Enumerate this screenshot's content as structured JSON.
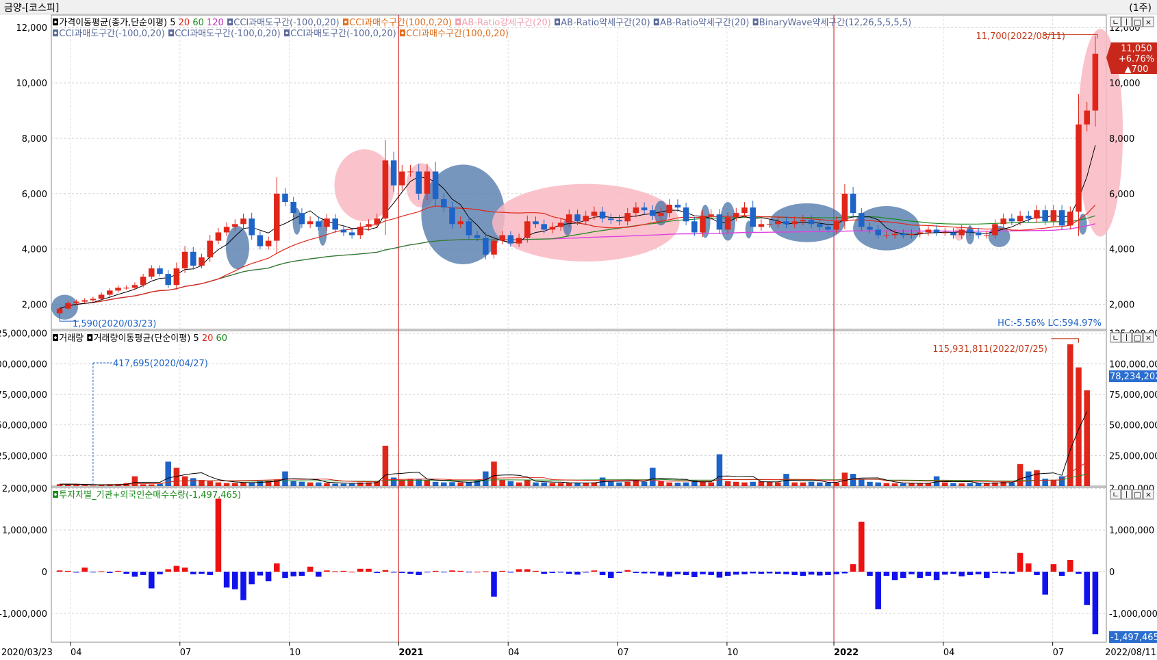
{
  "window": {
    "title": "금양-[코스피]",
    "period": "(1주)"
  },
  "colors": {
    "up": "#e0261a",
    "down": "#1e64c8",
    "ma5": "#000000",
    "ma20": "#e0261a",
    "ma60": "#1b8a1b",
    "ma120": "#e040e0",
    "pink_zone": "#f9b8c2",
    "blue_zone": "#4a73a8",
    "year_line": "#d43030"
  },
  "price_panel": {
    "legend_row1": [
      {
        "text": "가격이동평균(종가,단순이평)",
        "color": "#000000",
        "icon": "indicator-icon"
      },
      {
        "text": "5",
        "color": "#000000"
      },
      {
        "text": "20",
        "color": "#e0261a"
      },
      {
        "text": "60",
        "color": "#1b8a1b"
      },
      {
        "text": "120",
        "color": "#c030c0"
      },
      {
        "text": "CCI과매도구간(-100,0,20)",
        "color": "#5a6a9a",
        "icon": "indicator-icon"
      },
      {
        "text": "CCI과매수구간(100,0,20)",
        "color": "#e07020",
        "icon": "indicator-icon"
      },
      {
        "text": "AB-Ratio강세구간(20)",
        "color": "#f2a0b0",
        "icon": "indicator-icon"
      },
      {
        "text": "AB-Ratio약세구간(20)",
        "color": "#5a6a9a",
        "icon": "indicator-icon"
      },
      {
        "text": "AB-Ratio약세구간(20)",
        "color": "#5a6a9a",
        "icon": "indicator-icon"
      },
      {
        "text": "BinaryWave약세구간(12,26,5,5,5,5)",
        "color": "#5a6a9a",
        "icon": "indicator-icon"
      }
    ],
    "legend_row2": [
      {
        "text": "CCI과매도구간(-100,0,20)",
        "color": "#5a6a9a",
        "icon": "indicator-icon"
      },
      {
        "text": "CCI과매도구간(-100,0,20)",
        "color": "#5a6a9a",
        "icon": "indicator-icon"
      },
      {
        "text": "CCI과매도구간(-100,0,20)",
        "color": "#5a6a9a",
        "icon": "indicator-icon"
      },
      {
        "text": "CCI과매수구간(100,0,20)",
        "color": "#e07020",
        "icon": "indicator-icon"
      }
    ],
    "high_label": "11,700(2022/08/11)",
    "low_label": "1,590(2020/03/23)",
    "current_price": {
      "price": "11,050",
      "change_pct": "+6.76%",
      "change": "▲700"
    },
    "hc_lc": "HC:-5.56%  LC:594.97%",
    "window_buttons": [
      "ㄴ",
      "ㅣ",
      "□",
      "×"
    ]
  },
  "volume_panel": {
    "legend": [
      {
        "text": "거래량",
        "color": "#000000",
        "icon": "indicator-icon"
      },
      {
        "text": "거래량이동평균(단순이평)",
        "color": "#000000",
        "icon": "indicator-icon"
      },
      {
        "text": "5",
        "color": "#000000"
      },
      {
        "text": "20",
        "color": "#e0261a"
      },
      {
        "text": "60",
        "color": "#1b8a1b"
      }
    ],
    "high_label": "115,931,811(2022/07/25)",
    "low_label": "417,695(2020/04/27)",
    "current_value": "78,234,202",
    "window_buttons": [
      "ㄴ",
      "ㅣ",
      "□",
      "×"
    ]
  },
  "investor_panel": {
    "legend": [
      {
        "text": "투자자별_기관+외국인순매수수량(-1,497,465)",
        "color": "#1b8a1b",
        "icon": "indicator-icon"
      }
    ],
    "current_value": "-1,497,465",
    "window_buttons": [
      "ㄴ",
      "ㅣ",
      "□",
      "×"
    ]
  },
  "x_axis": {
    "start_label": "2020/03/23",
    "end_label": "2022/08/11",
    "ticks": [
      {
        "label": "04",
        "week": 1.3,
        "bold": false
      },
      {
        "label": "07",
        "week": 14.4,
        "bold": false
      },
      {
        "label": "10",
        "week": 27.5,
        "bold": false
      },
      {
        "label": "2021",
        "week": 40.6,
        "bold": true
      },
      {
        "label": "04",
        "week": 53.7,
        "bold": false
      },
      {
        "label": "07",
        "week": 66.8,
        "bold": false
      },
      {
        "label": "10",
        "week": 79.9,
        "bold": false
      },
      {
        "label": "2022",
        "week": 92.7,
        "bold": true
      },
      {
        "label": "04",
        "week": 105.8,
        "bold": false
      },
      {
        "label": "07",
        "week": 118.9,
        "bold": false
      }
    ],
    "year_lines_week": [
      40.6,
      92.7
    ]
  },
  "chart_data": [
    {
      "type": "candlestick",
      "x_unit": "week index from 2020/03/23",
      "y_ticks": [
        {
          "v": 2000,
          "label": "2,000"
        },
        {
          "v": 4000,
          "label": "4,000"
        },
        {
          "v": 6000,
          "label": "6,000"
        },
        {
          "v": 8000,
          "label": "8,000"
        },
        {
          "v": 10000,
          "label": "10,000"
        },
        {
          "v": 12000,
          "label": "12,000"
        }
      ],
      "ylim": [
        1100,
        12450
      ],
      "close": [
        1850,
        2050,
        2100,
        2150,
        2200,
        2350,
        2500,
        2600,
        2600,
        2700,
        3000,
        3300,
        3100,
        2700,
        3300,
        3900,
        3400,
        3700,
        4300,
        4600,
        4800,
        4900,
        5100,
        4500,
        4100,
        4300,
        6000,
        5700,
        5300,
        4900,
        5000,
        4800,
        5100,
        4700,
        4600,
        4500,
        4800,
        4900,
        5100,
        7200,
        6300,
        6800,
        6800,
        6000,
        6800,
        5800,
        5500,
        4900,
        5000,
        4500,
        4400,
        3800,
        4300,
        4500,
        4200,
        4400,
        5000,
        4900,
        4700,
        4800,
        4950,
        5250,
        5000,
        5200,
        5350,
        5100,
        5050,
        5000,
        5300,
        5500,
        5400,
        5200,
        5300,
        5600,
        5500,
        5000,
        4600,
        5200,
        5250,
        4700,
        5150,
        5300,
        5500,
        4800,
        4900,
        4900,
        5000,
        4900,
        5000,
        5050,
        4900,
        4800,
        4700,
        5000,
        6000,
        5300,
        4800,
        4700,
        4500,
        4500,
        4550,
        4500,
        4550,
        4600,
        4700,
        4600,
        4600,
        4500,
        4700,
        4600,
        4500,
        4500,
        4900,
        5100,
        5000,
        5200,
        5100,
        5400,
        5000,
        5400,
        4850,
        5350,
        8500,
        9000,
        11050
      ],
      "ma_legend_periods": [
        5,
        20,
        60,
        120
      ],
      "high_point": {
        "week": 124,
        "value": 11700
      },
      "low_point": {
        "week": 0,
        "value": 1590
      },
      "zones": [
        {
          "kind": "blue",
          "cx": 0.6,
          "cy": 1900,
          "rx": 1.6,
          "ry": 450
        },
        {
          "kind": "blue",
          "cx": 21.3,
          "cy": 4050,
          "rx": 1.4,
          "ry": 780
        },
        {
          "kind": "blue",
          "cx": 28.4,
          "cy": 5000,
          "rx": 0.5,
          "ry": 480
        },
        {
          "kind": "blue",
          "cx": 31.5,
          "cy": 4600,
          "rx": 0.5,
          "ry": 480
        },
        {
          "kind": "pink",
          "cx": 36.5,
          "cy": 6300,
          "rx": 3.6,
          "ry": 1300
        },
        {
          "kind": "pink",
          "cx": 43.3,
          "cy": 6300,
          "rx": 1.8,
          "ry": 800
        },
        {
          "kind": "blue",
          "cx": 48.3,
          "cy": 5250,
          "rx": 5.0,
          "ry": 1800
        },
        {
          "kind": "pink",
          "cx": 63.0,
          "cy": 4950,
          "rx": 11.2,
          "ry": 1400
        },
        {
          "kind": "blue",
          "cx": 60.8,
          "cy": 4800,
          "rx": 0.5,
          "ry": 320
        },
        {
          "kind": "blue",
          "cx": 72.0,
          "cy": 5300,
          "rx": 0.8,
          "ry": 450
        },
        {
          "kind": "blue",
          "cx": 77.3,
          "cy": 5000,
          "rx": 0.6,
          "ry": 600
        },
        {
          "kind": "blue",
          "cx": 80.0,
          "cy": 5000,
          "rx": 0.9,
          "ry": 700
        },
        {
          "kind": "blue",
          "cx": 82.5,
          "cy": 4700,
          "rx": 0.4,
          "ry": 320
        },
        {
          "kind": "blue",
          "cx": 89.5,
          "cy": 4950,
          "rx": 4.5,
          "ry": 700
        },
        {
          "kind": "blue",
          "cx": 99.0,
          "cy": 4750,
          "rx": 4.0,
          "ry": 800
        },
        {
          "kind": "pink",
          "cx": 107.7,
          "cy": 4550,
          "rx": 0.6,
          "ry": 250
        },
        {
          "kind": "blue",
          "cx": 109.0,
          "cy": 4500,
          "rx": 0.5,
          "ry": 330
        },
        {
          "kind": "blue",
          "cx": 112.5,
          "cy": 4450,
          "rx": 1.3,
          "ry": 380
        },
        {
          "kind": "blue",
          "cx": 122.5,
          "cy": 4900,
          "rx": 0.5,
          "ry": 380
        },
        {
          "kind": "pink",
          "cx": 124.6,
          "cy": 8200,
          "rx": 2.7,
          "ry": 3750
        }
      ]
    },
    {
      "type": "bar",
      "title": "거래량",
      "x_unit": "week index from 2020/03/23",
      "y_ticks": [
        {
          "v": 25000000,
          "label": "25,000,000"
        },
        {
          "v": 50000000,
          "label": "50,000,000"
        },
        {
          "v": 75000000,
          "label": "75,000,000"
        },
        {
          "v": 100000000,
          "label": "100,000,000"
        },
        {
          "v": 125000000,
          "label": "125,000,000"
        }
      ],
      "ylim": [
        0,
        127000000
      ],
      "values": [
        1500000,
        1800000,
        1200000,
        900000,
        417695,
        1000000,
        1500000,
        1600000,
        2500000,
        8000000,
        1500000,
        1400000,
        2000000,
        20000000,
        15000000,
        8000000,
        6500000,
        5000000,
        4000000,
        3000000,
        2500000,
        2600000,
        3000000,
        3000000,
        4000000,
        4500000,
        5500000,
        12000000,
        4000000,
        3500000,
        3000000,
        3000000,
        2500000,
        2000000,
        2000000,
        2000000,
        3000000,
        3000000,
        4000000,
        33000000,
        7000000,
        5000000,
        6000000,
        5500000,
        5000000,
        3500000,
        3000000,
        3200000,
        3000000,
        3000000,
        5000000,
        12000000,
        20000000,
        5000000,
        4000000,
        3000000,
        5000000,
        3000000,
        3000000,
        2500000,
        2500000,
        2700000,
        2500000,
        2800000,
        3000000,
        7000000,
        4000000,
        3000000,
        3500000,
        5000000,
        3500000,
        15000000,
        4000000,
        3000000,
        2800000,
        3000000,
        5000000,
        3500000,
        3000000,
        26000000,
        4000000,
        3500000,
        3000000,
        3500000,
        4000000,
        3500000,
        3000000,
        10000000,
        3000000,
        3000000,
        3500000,
        3000000,
        2800000,
        2800000,
        11000000,
        10000000,
        6000000,
        3500000,
        3000000,
        2500000,
        2200000,
        2200000,
        2300000,
        2400000,
        2500000,
        8000000,
        3000000,
        2500000,
        2200000,
        2500000,
        2500000,
        2200000,
        3000000,
        3500000,
        3000000,
        18000000,
        12000000,
        13000000,
        6000000,
        5000000,
        8000000,
        115931811,
        97000000,
        78234202
      ],
      "colors_by_candle": true,
      "high_point": {
        "week": 122,
        "value": 115931811
      },
      "low_point": {
        "week": 4,
        "value": 417695
      }
    },
    {
      "type": "bar",
      "title": "투자자별_기관+외국인순매수수량",
      "x_unit": "week index from 2020/03/23",
      "y_ticks": [
        {
          "v": -1000000,
          "label": "-1,000,000"
        },
        {
          "v": 0,
          "label": "0"
        },
        {
          "v": 1000000,
          "label": "1,000,000"
        },
        {
          "v": 2000000,
          "label": "2,000,000"
        }
      ],
      "ylim": [
        -1690000,
        2020000
      ],
      "values": [
        30000,
        20000,
        -20000,
        100000,
        -10000,
        10000,
        -30000,
        20000,
        -50000,
        -120000,
        -80000,
        -400000,
        -60000,
        60000,
        140000,
        100000,
        -60000,
        -50000,
        -80000,
        1750000,
        -380000,
        -420000,
        -680000,
        -300000,
        -90000,
        -230000,
        200000,
        -150000,
        -110000,
        -100000,
        120000,
        -120000,
        30000,
        10000,
        20000,
        0,
        70000,
        70000,
        -30000,
        40000,
        -20000,
        -30000,
        -50000,
        -80000,
        -10000,
        20000,
        -10000,
        30000,
        20000,
        -10000,
        0,
        10000,
        -600000,
        20000,
        -20000,
        60000,
        60000,
        20000,
        -50000,
        -30000,
        -20000,
        -50000,
        -70000,
        -20000,
        30000,
        -80000,
        -150000,
        -30000,
        40000,
        -30000,
        -40000,
        -40000,
        -90000,
        -120000,
        -60000,
        -80000,
        -130000,
        -60000,
        -80000,
        -140000,
        -100000,
        -70000,
        -60000,
        -40000,
        -50000,
        -40000,
        -50000,
        -60000,
        -80000,
        -100000,
        -70000,
        -90000,
        -80000,
        -60000,
        -40000,
        180000,
        1200000,
        -100000,
        -900000,
        -100000,
        -200000,
        -150000,
        -60000,
        -150000,
        -100000,
        -200000,
        -70000,
        -50000,
        -110000,
        -80000,
        -60000,
        -150000,
        -30000,
        -40000,
        -50000,
        450000,
        200000,
        -80000,
        -550000,
        180000,
        -100000,
        280000,
        -50000,
        -800000,
        -1497465
      ]
    }
  ]
}
